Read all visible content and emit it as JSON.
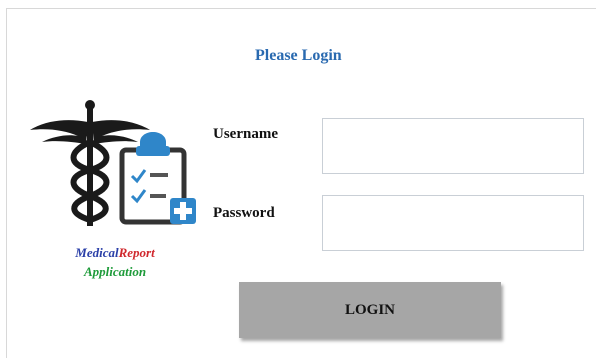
{
  "form": {
    "title": "Please Login",
    "username_label": "Username",
    "password_label": "Password",
    "username_value": "",
    "password_value": "",
    "login_label": "LOGIN"
  },
  "logo": {
    "icons": [
      "caduceus-icon",
      "clipboard-checklist-icon",
      "plus-badge-icon"
    ],
    "line1_word1": "Medical",
    "line1_word2": "Report",
    "line2": "Application"
  },
  "colors": {
    "title": "#2a6ab0",
    "button": "#a6a6a6",
    "medical_text": "#2a3fa8",
    "report_text": "#d0282d",
    "application_text": "#1e9b3a",
    "clipboard_blue": "#2f86c9"
  }
}
